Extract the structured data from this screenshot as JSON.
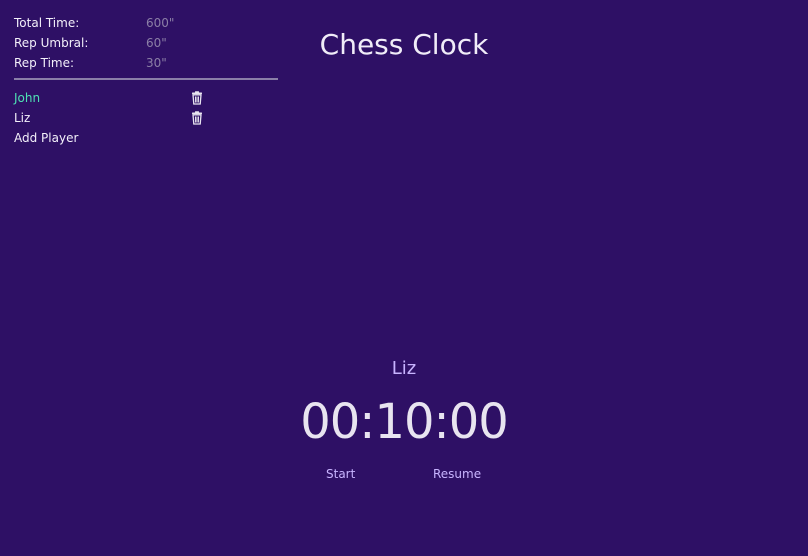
{
  "settings": [
    {
      "label": "Total Time:",
      "value": "600\""
    },
    {
      "label": "Rep Umbral:",
      "value": "60\""
    },
    {
      "label": "Rep Time:",
      "value": "30\""
    }
  ],
  "players": [
    {
      "name": "John",
      "active": true
    },
    {
      "name": "Liz",
      "active": false
    }
  ],
  "add_player_label": "Add Player",
  "title": "Chess Clock",
  "current_player": "Liz",
  "clock_display": "00:10:00",
  "controls": {
    "start_label": "Start",
    "resume_label": "Resume"
  },
  "icons": {
    "delete": "trash-icon"
  },
  "colors": {
    "background": "#2e1065",
    "active_player": "#4ee0b4",
    "accent": "#c8b4ff"
  }
}
